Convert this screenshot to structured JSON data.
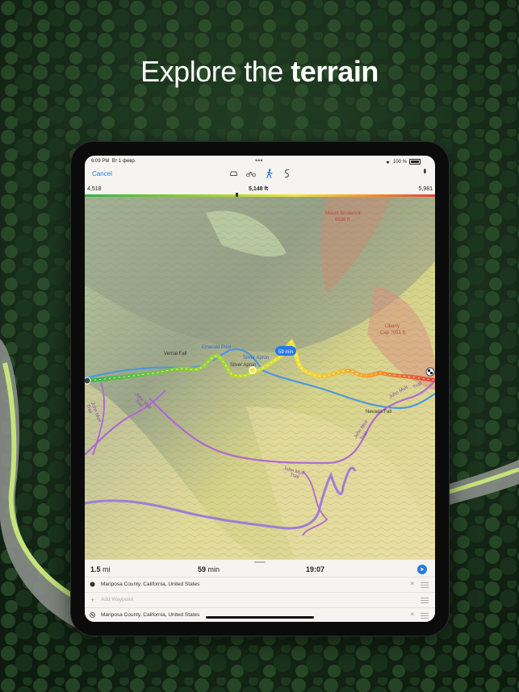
{
  "headline": {
    "normal": "Explore the",
    "bold": "terrain"
  },
  "status_bar": {
    "time": "6:09 PM",
    "date": "Вт 1 февр.",
    "battery": "100 %"
  },
  "toolbar": {
    "cancel_label": "Cancel",
    "modes": [
      "car-icon",
      "bike-icon",
      "hike-icon",
      "route-icon"
    ],
    "active_mode": "hike-icon"
  },
  "elevation": {
    "min": "4,518",
    "current": "5,148 ft",
    "max": "5,981"
  },
  "map": {
    "labels": {
      "mount_broderick": "Mount Broderick",
      "mount_broderick_elev": "6696 ft",
      "liberty": "Liberty",
      "liberty_elev": "Cap 7051 ft",
      "vernal_fall": "Vernal Fall",
      "emerald_pool": "Emerald Pool",
      "silver_apron": "Silver Apron",
      "silver_apron2": "Silver Apron",
      "nevada_fall": "Nevada Fall",
      "john_muir_1": "John Muir",
      "john_muir_1b": "Trail",
      "john_muir_2": "John Muir",
      "john_muir_2b": "Trail",
      "john_muir_3": "John Muir",
      "john_muir_3b": "Trail",
      "john_muir_4": "John Muir",
      "john_muir_4b": "Trail",
      "john_muir_5": "John Muir",
      "john_muir_5b": "Trail",
      "route_time": "59 min"
    },
    "colors": {
      "route_start": "#39b54a",
      "route_mid": "#f3e43a",
      "route_end": "#e2433a",
      "trail_purple": "#b06ad0",
      "river_blue": "#4d97dd"
    }
  },
  "summary": {
    "distance_value": "1.5",
    "distance_unit": "mi",
    "duration_value": "59",
    "duration_unit": "min",
    "eta": "19:07"
  },
  "waypoints": [
    {
      "label": "Mariposa County, California, United States",
      "icon": "start-dot-icon"
    },
    {
      "label": "Add Waypoint",
      "icon": "plus-icon"
    },
    {
      "label": "Mariposa County, California, United States",
      "icon": "finish-flag-icon"
    }
  ]
}
